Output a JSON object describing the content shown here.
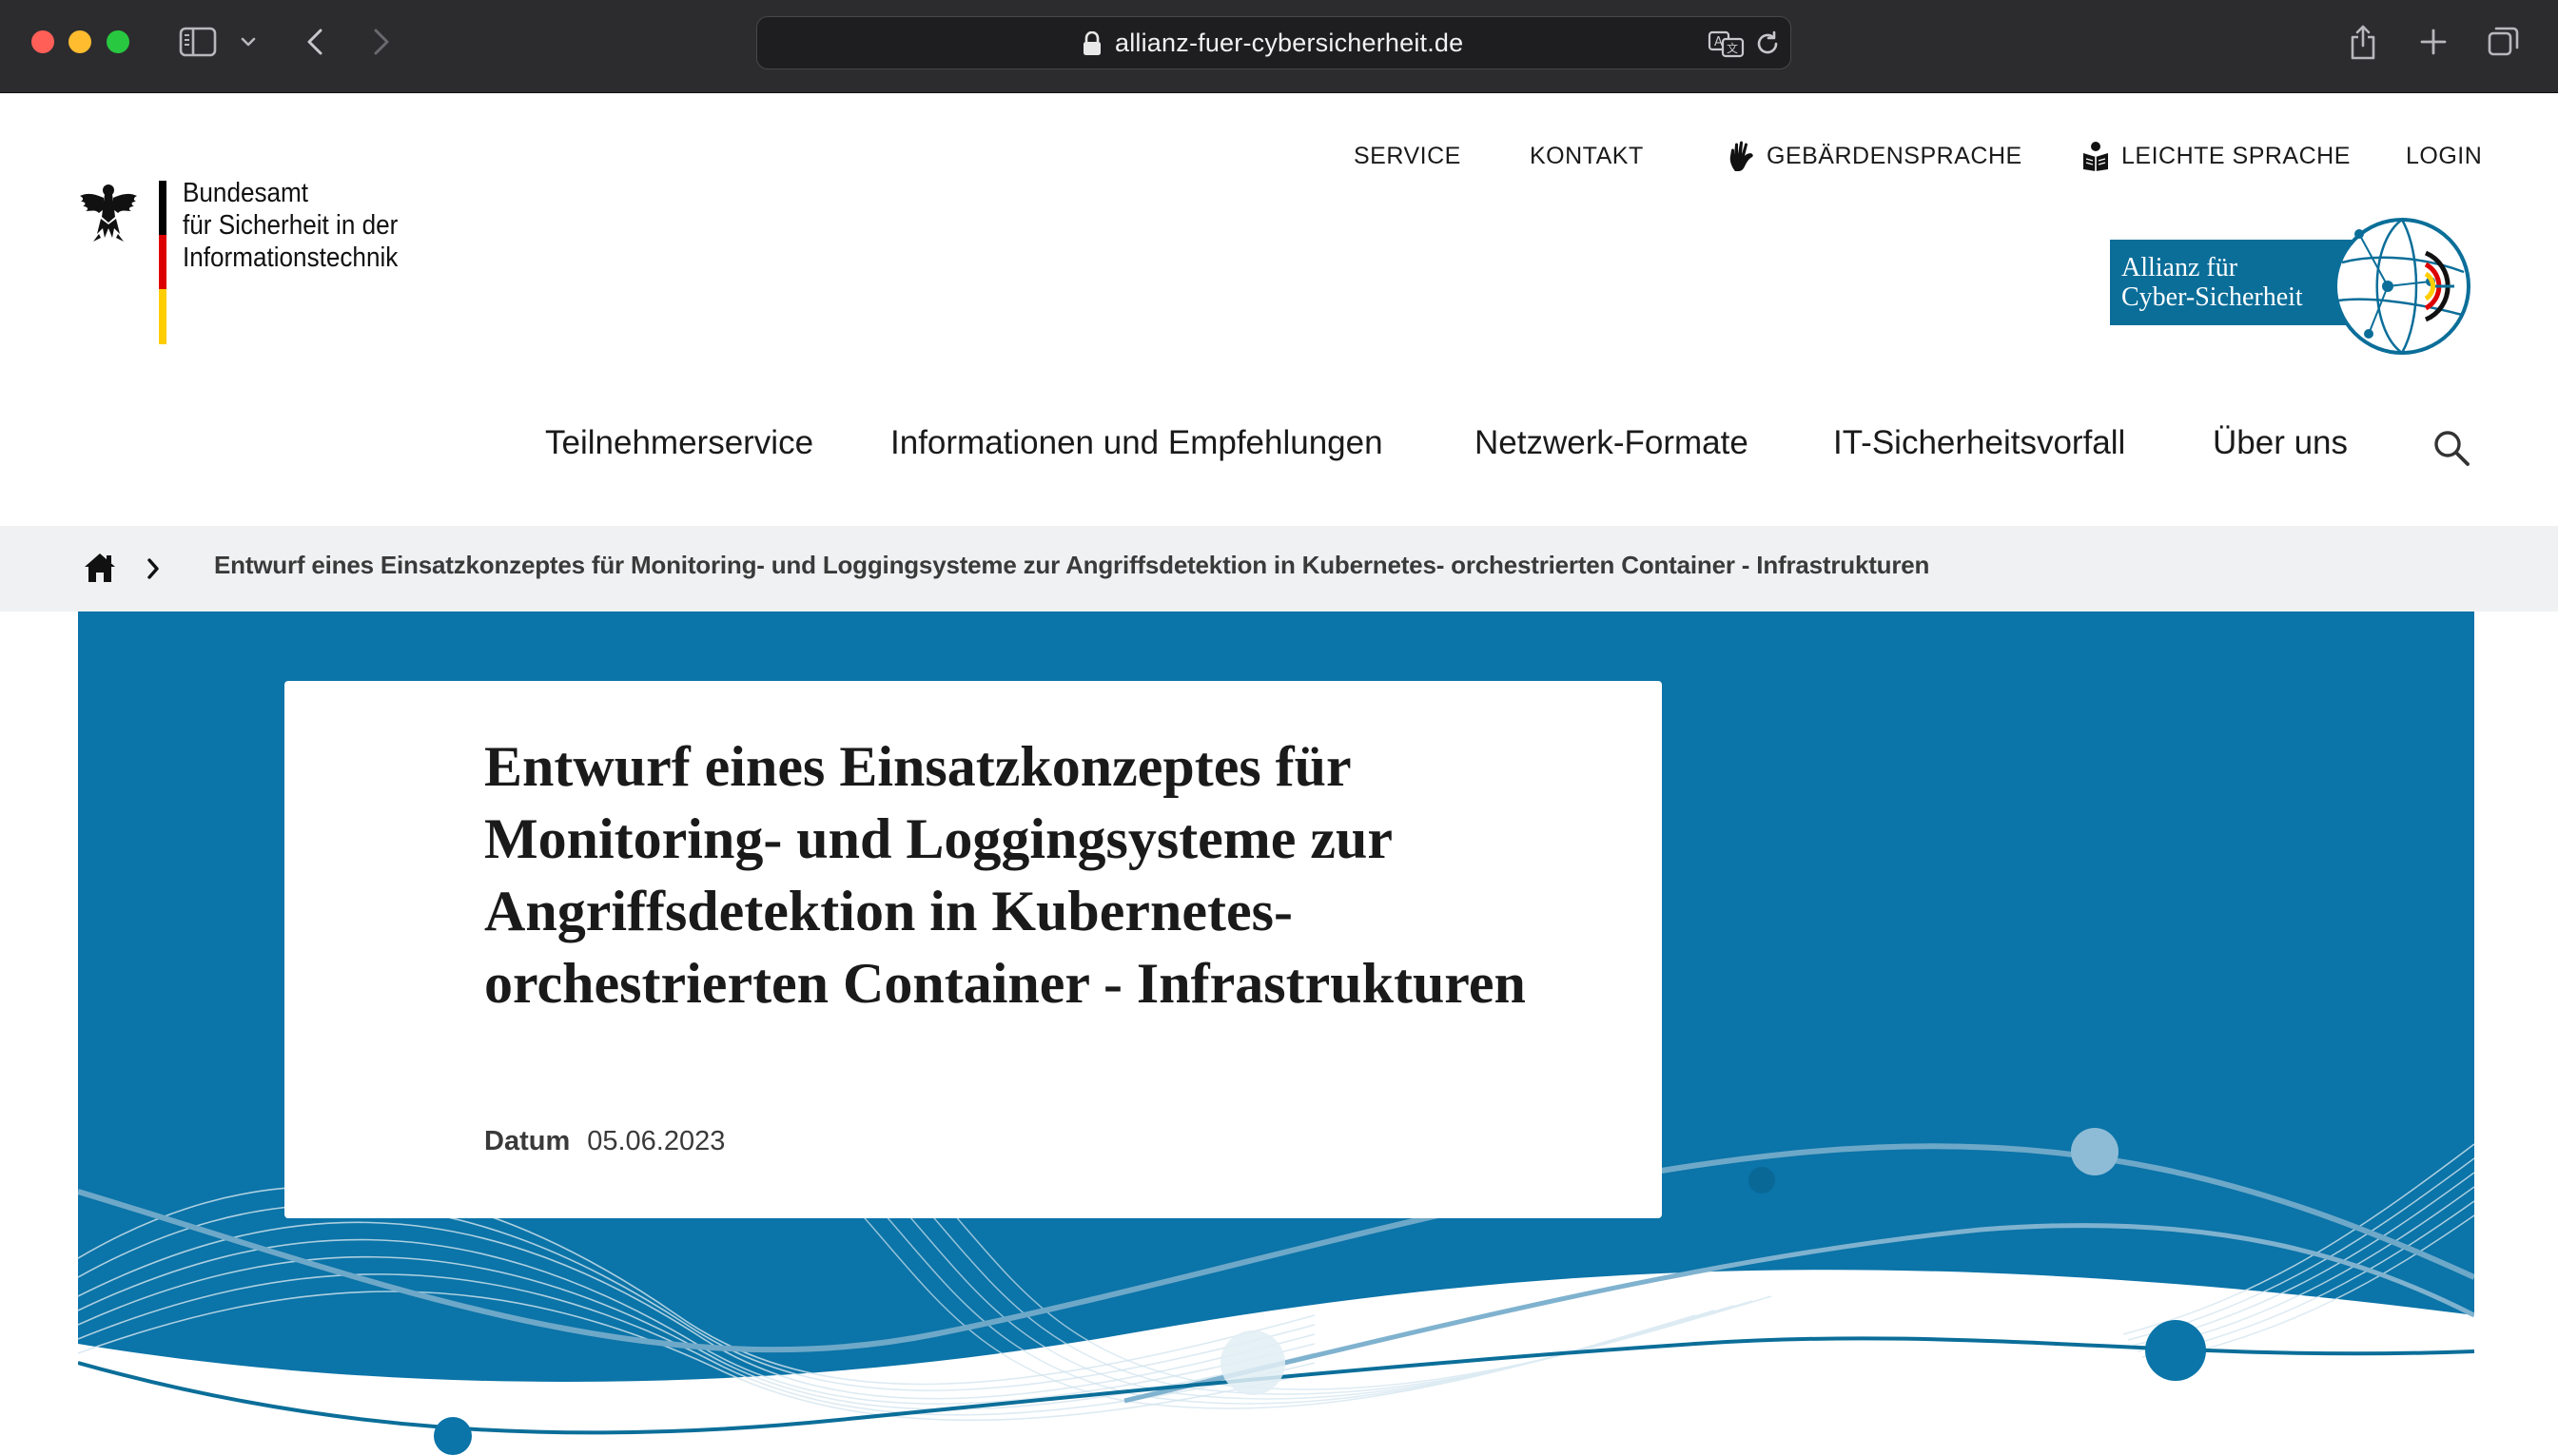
{
  "browser": {
    "url": "allianz-fuer-cybersicherheit.de",
    "colors": {
      "chrome_bg": "#2c2c2e",
      "close": "#ff5f57",
      "minimize": "#febc2e",
      "zoom": "#28c840"
    }
  },
  "header": {
    "bsi_logo_lines": [
      "Bundesamt",
      "für Sicherheit in der",
      "Informationstechnik"
    ],
    "service_nav": {
      "service": "SERVICE",
      "kontakt": "KONTAKT",
      "gebaerdensprache": "GEBÄRDENSPRACHE",
      "leichte_sprache": "LEICHTE SPRACHE",
      "login": "LOGIN"
    },
    "acs_logo_lines": [
      "Allianz für",
      "Cyber-Sicherheit"
    ]
  },
  "main_nav": {
    "items": [
      "Teilnehmerservice",
      "Informationen und Empfehlungen",
      "Netzwerk-Formate",
      "IT-Sicherheitsvorfall",
      "Über uns"
    ]
  },
  "breadcrumb": {
    "current": "Entwurf eines Einsatzkonzeptes für Monitoring- und Loggingsysteme zur Angriffsdetektion in Kubernetes- orchestrierten Container - Infrastrukturen"
  },
  "hero": {
    "title": "Entwurf eines Einsatzkonzeptes für Monitoring- und Loggingsysteme zur Angriffsdetektion in Kubernetes-orchestrierten Container - Infrastrukturen",
    "date_label": "Datum",
    "date_value": "05.06.2023",
    "colors": {
      "background": "#0b74a8",
      "accent": "#0b6e99"
    }
  }
}
